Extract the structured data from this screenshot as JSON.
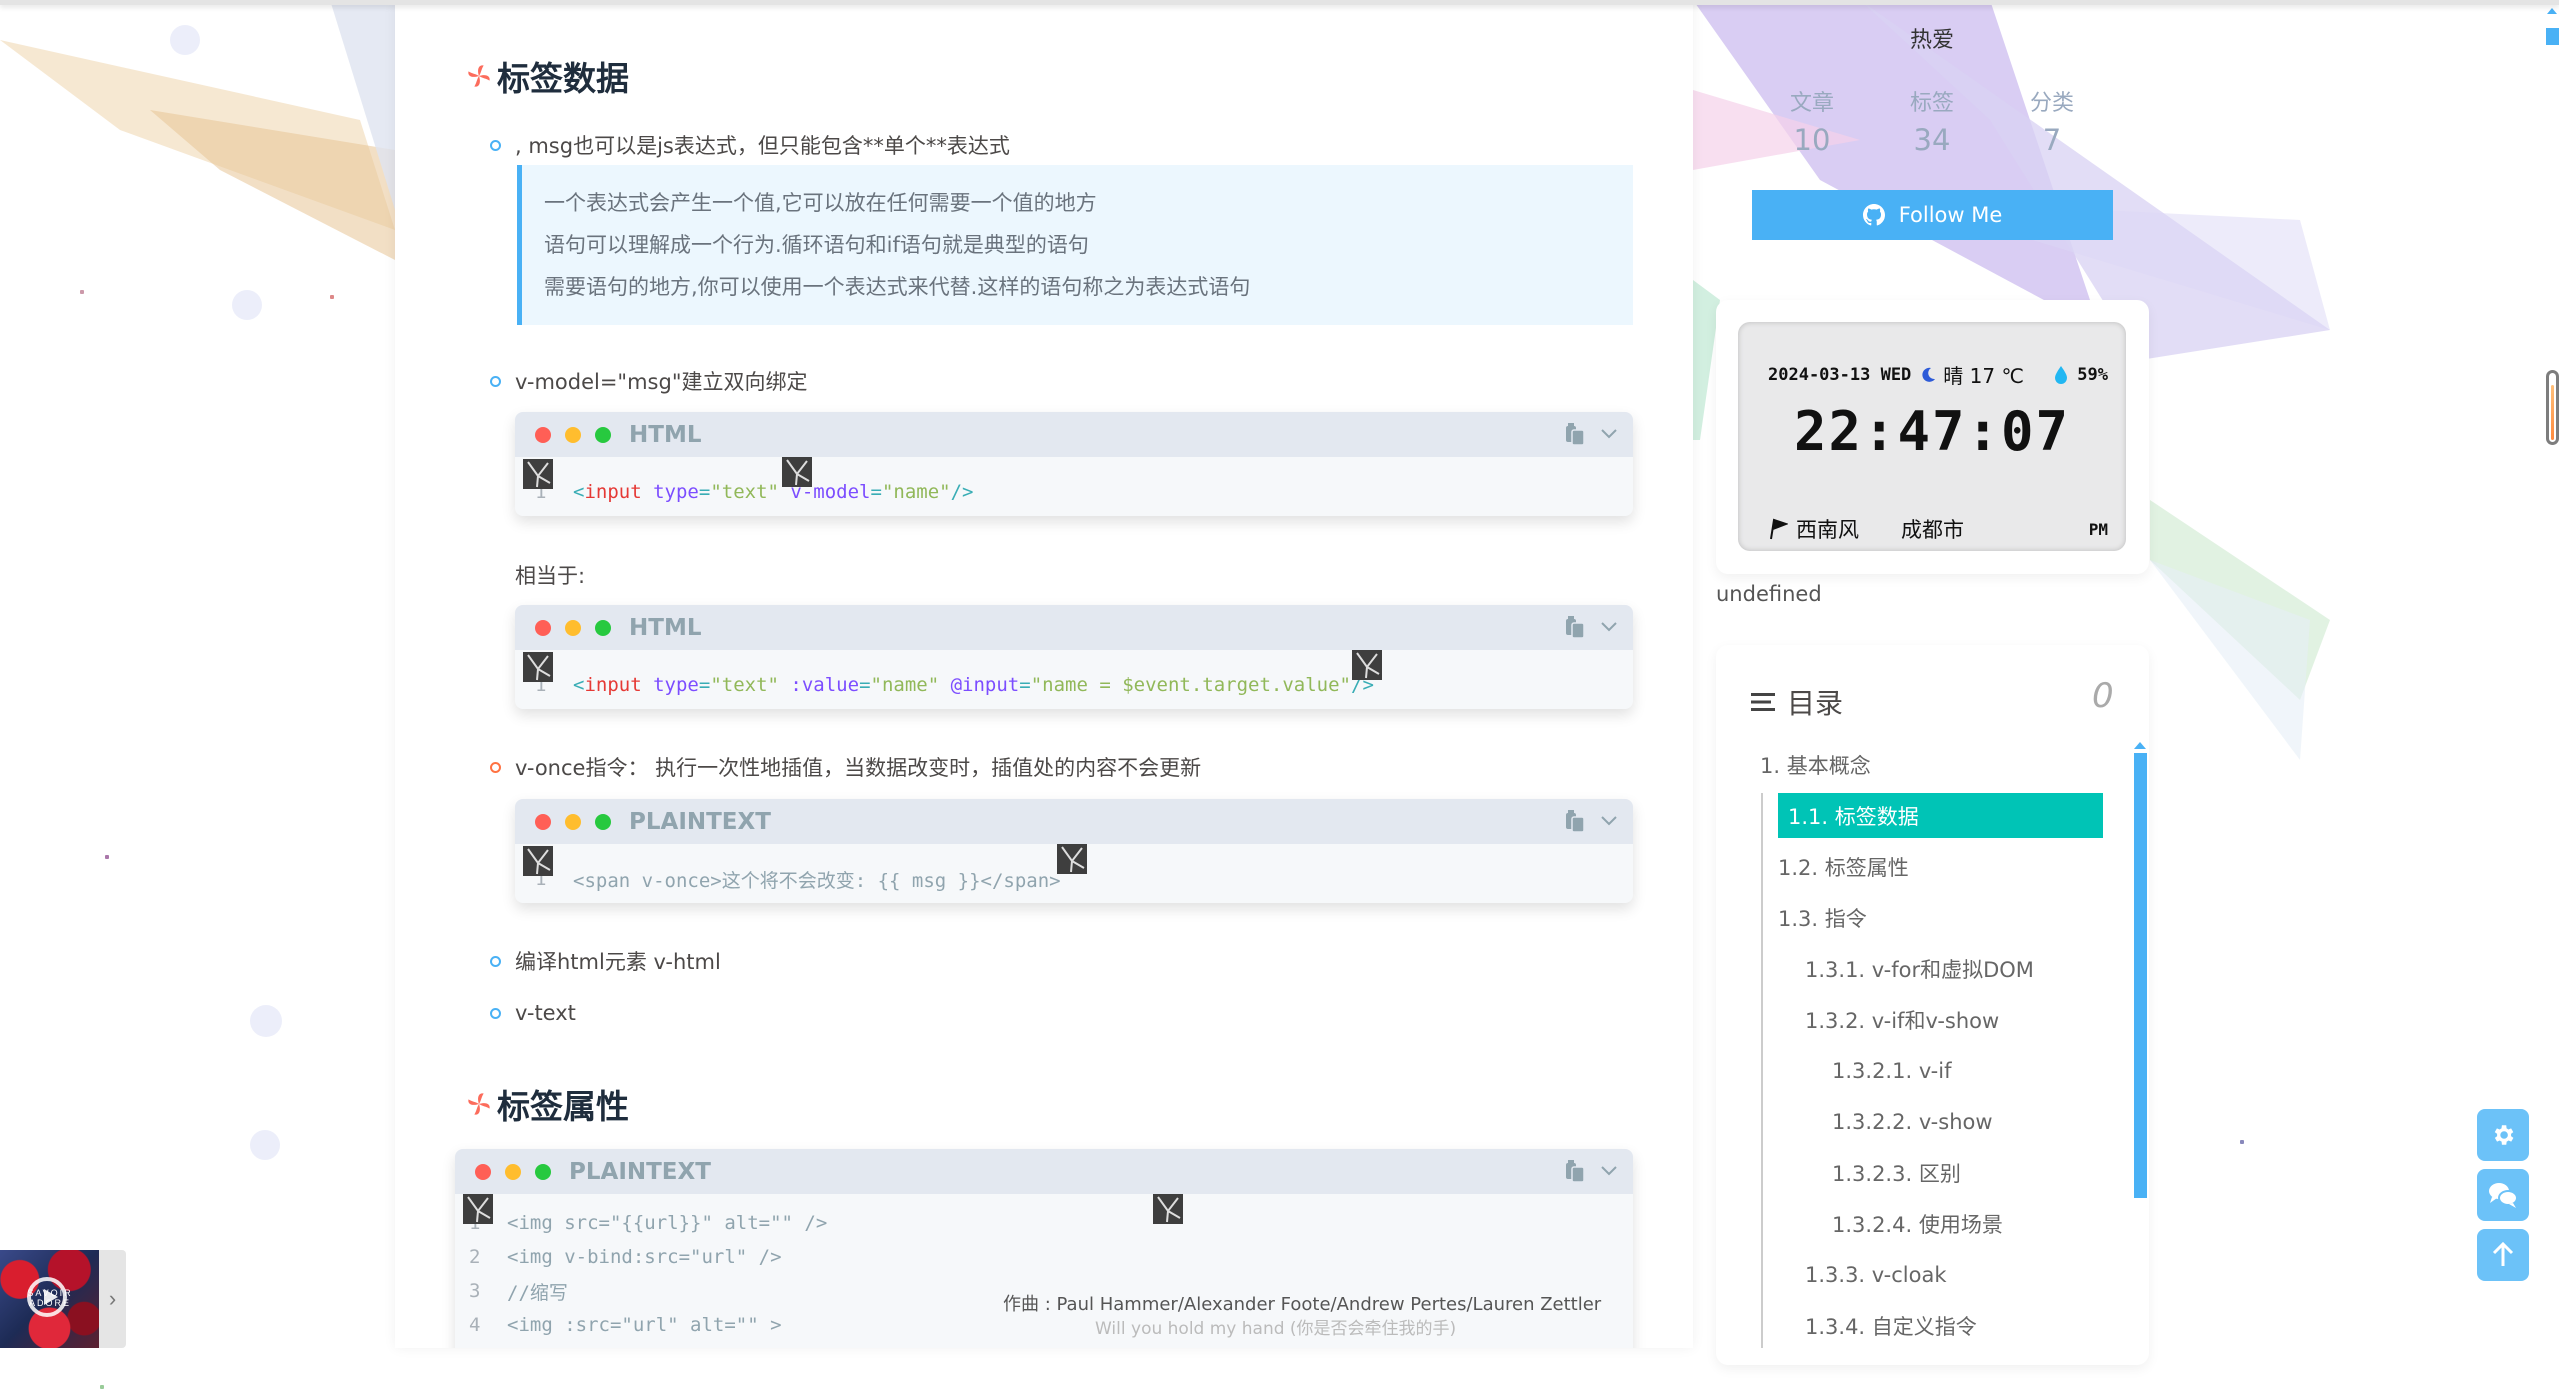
{
  "article": {
    "sections": [
      {
        "heading": "标签数据"
      },
      {
        "heading": "标签属性"
      }
    ],
    "bullets": [
      ", msg也可以是js表达式，但只能包含**单个**表达式",
      "v-model=\"msg\"建立双向绑定",
      "v-once指令： 执行一次性地插值，当数据改变时，插值处的内容不会更新",
      "编译html元素 v-html",
      "v-text"
    ],
    "quote_lines": [
      "一个表达式会产生一个值,它可以放在任何需要一个值的地方",
      "语句可以理解成一个行为.循环语句和if语句就是典型的语句",
      "需要语句的地方,你可以使用一个表达式来代替.这样的语句称之为表达式语句"
    ],
    "equivalent_label": "相当于:",
    "code_blocks": [
      {
        "lang": "HTML",
        "lines": [
          "<input type=\"text\" v-model=\"name\"/>"
        ]
      },
      {
        "lang": "HTML",
        "lines": [
          "<input type=\"text\" :value=\"name\" @input=\"name = $event.target.value\"/>"
        ]
      },
      {
        "lang": "PLAINTEXT",
        "lines": [
          "<span v-once>这个将不会改变: {{ msg }}</span>"
        ]
      },
      {
        "lang": "PLAINTEXT",
        "lines": [
          "<img src=\"{{url}}\" alt=\"\" />",
          "<img v-bind:src=\"url\" />",
          "//缩写",
          "<img :src=\"url\" alt=\"\" >"
        ]
      }
    ],
    "line_numbers": [
      "1",
      "2",
      "3",
      "4"
    ]
  },
  "lyrics": {
    "line1": "作曲 : Paul Hammer/Alexander Foote/Andrew Pertes/Lauren Zettler",
    "line2": "Will you hold my hand (你是否会牵住我的手)"
  },
  "profile": {
    "motto": "热爱",
    "stats": [
      {
        "label": "文章",
        "value": "10"
      },
      {
        "label": "标签",
        "value": "34"
      },
      {
        "label": "分类",
        "value": "7"
      }
    ],
    "follow_label": "Follow Me"
  },
  "weather_clock": {
    "date": "2024-03-13 WED",
    "weather": "晴 17 ℃",
    "humidity": "59%",
    "time": "22:47:07",
    "wind": "西南风",
    "city": "成都市",
    "ampm": "PM"
  },
  "undefined_text": "undefined",
  "toc": {
    "title": "目录",
    "percent": "0",
    "items": [
      {
        "label": "1. 基本概念",
        "level": 1
      },
      {
        "label": "1.1. 标签数据",
        "level": 2,
        "active": true
      },
      {
        "label": "1.2. 标签属性",
        "level": 2
      },
      {
        "label": "1.3. 指令",
        "level": 2
      },
      {
        "label": "1.3.1. v-for和虚拟DOM",
        "level": 3
      },
      {
        "label": "1.3.2. v-if和v-show",
        "level": 3
      },
      {
        "label": "1.3.2.1. v-if",
        "level": 4
      },
      {
        "label": "1.3.2.2. v-show",
        "level": 4
      },
      {
        "label": "1.3.2.3. 区别",
        "level": 4
      },
      {
        "label": "1.3.2.4. 使用场景",
        "level": 4
      },
      {
        "label": "1.3.3. v-cloak",
        "level": 3
      },
      {
        "label": "1.3.4. 自定义指令",
        "level": 3
      }
    ]
  },
  "music_player": {
    "album_text": "SAVOIR ADORE"
  },
  "reading_progress": 0.8,
  "colors": {
    "accent": "#49b1f5",
    "toc_active": "#00c4b6",
    "dot_red": "#ff5f56",
    "dot_yellow": "#ffbd2e",
    "dot_green": "#27c93f"
  }
}
